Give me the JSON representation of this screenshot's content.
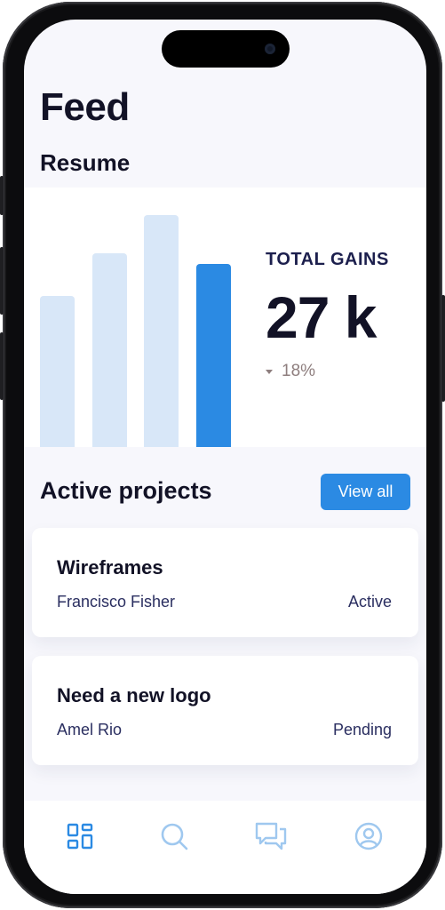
{
  "page": {
    "title": "Feed"
  },
  "resume": {
    "title": "Resume"
  },
  "stats": {
    "label": "TOTAL GAINS",
    "value": "27 k",
    "change": "18%"
  },
  "chart_data": {
    "type": "bar",
    "values": [
      170,
      218,
      261,
      206
    ],
    "highlight_index": 3,
    "colors": {
      "bar": "#d8e7f8",
      "highlight": "#2b8ae3"
    }
  },
  "projects": {
    "title": "Active projects",
    "view_all_label": "View all",
    "items": [
      {
        "name": "Wireframes",
        "owner": "Francisco Fisher",
        "status": "Active"
      },
      {
        "name": "Need a new logo",
        "owner": "Amel Rio",
        "status": "Pending"
      }
    ]
  },
  "tabs": [
    {
      "icon": "dashboard-icon",
      "active": true
    },
    {
      "icon": "search-icon",
      "active": false
    },
    {
      "icon": "messages-icon",
      "active": false
    },
    {
      "icon": "profile-icon",
      "active": false
    }
  ],
  "colors": {
    "accent": "#2b8ae3",
    "text": "#121226",
    "muted": "#8e7e7e"
  }
}
